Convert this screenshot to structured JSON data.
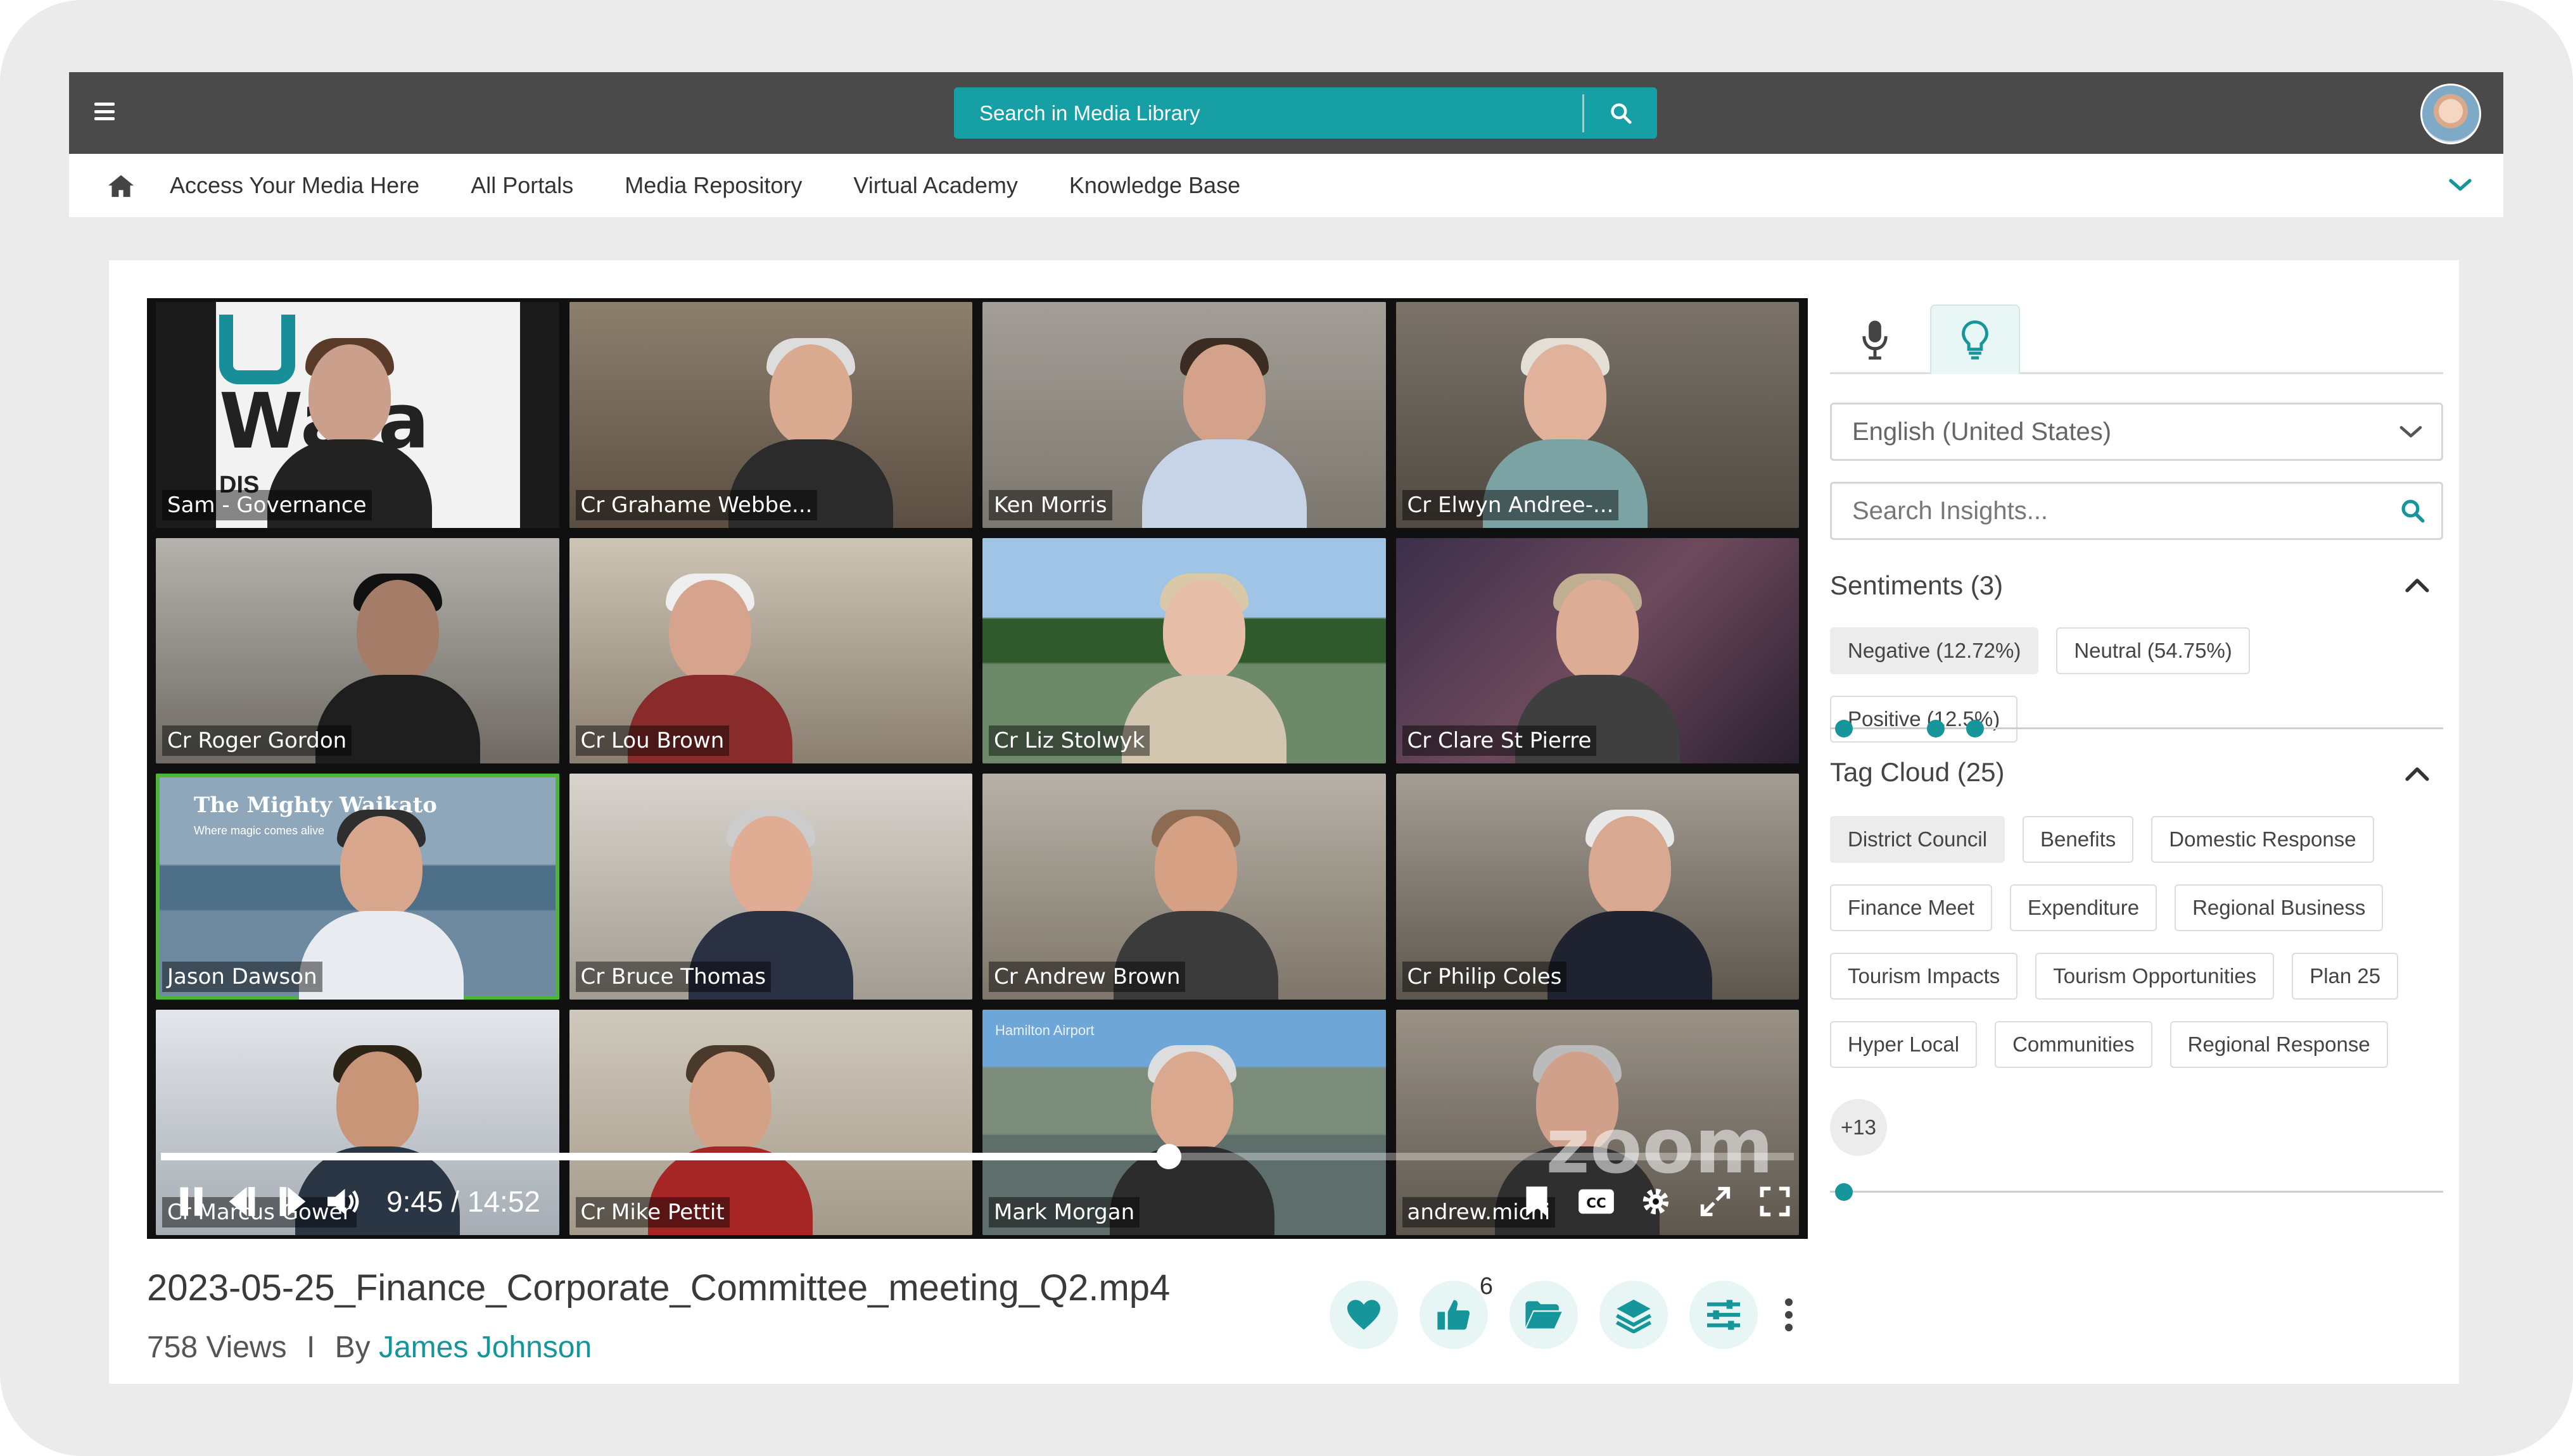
{
  "colors": {
    "topbar": "#4a4a4a",
    "accent": "#16a0a5",
    "link": "#16969b",
    "active_speaker": "#4fb43a"
  },
  "header": {
    "search_placeholder": "Search in Media Library",
    "menu_icon": "hamburger-icon",
    "search_icon": "search-icon",
    "avatar_icon": "user-avatar"
  },
  "nav": {
    "home_icon": "home-icon",
    "items": [
      {
        "label": "Access Your Media Here"
      },
      {
        "label": "All Portals"
      },
      {
        "label": "Media Repository"
      },
      {
        "label": "Virtual Academy"
      },
      {
        "label": "Knowledge Base"
      }
    ],
    "expand_icon": "chevron-down-icon"
  },
  "video": {
    "participants": [
      {
        "name": "Sam - Governance"
      },
      {
        "name": "Cr Grahame Webbe..."
      },
      {
        "name": "Ken Morris"
      },
      {
        "name": "Cr Elwyn Andree-..."
      },
      {
        "name": "Cr Roger Gordon"
      },
      {
        "name": "Cr Lou Brown"
      },
      {
        "name": "Cr Liz Stolwyk"
      },
      {
        "name": "Cr Clare St Pierre"
      },
      {
        "name": "Jason Dawson"
      },
      {
        "name": "Cr Bruce Thomas"
      },
      {
        "name": "Cr Andrew Brown"
      },
      {
        "name": "Cr Philip Coles"
      },
      {
        "name": "Cr Marcus Gower"
      },
      {
        "name": "Cr Mike Pettit"
      },
      {
        "name": "Mark Morgan"
      },
      {
        "name": "andrew.michi"
      }
    ],
    "logo_text": "Wa   a",
    "logo_sub": "DIS              IL",
    "sign_text": "The Mighty Waikato",
    "sign_sub": "Where magic comes alive",
    "airport_text": "Hamilton Airport",
    "zoom_watermark": "zoom",
    "time_display": "9:45 / 14:52",
    "progress": 0.617,
    "active_speaker": "Jason Dawson"
  },
  "media": {
    "title": "2023-05-25_Finance_Corporate_Committee_meeting_Q2.mp4",
    "views": "758 Views",
    "separator": "I",
    "by": "By",
    "author": "James Johnson",
    "like_count": "6",
    "action_icons": [
      "heart-icon",
      "thumbs-up-icon",
      "folder-icon",
      "layers-icon",
      "sliders-icon",
      "more-vertical-icon"
    ]
  },
  "insights": {
    "tabs": [
      "microphone-icon",
      "lightbulb-icon"
    ],
    "language": "English (United States)",
    "search_placeholder": "Search Insights...",
    "sentiments": {
      "title": "Sentiments (3)",
      "chips": [
        "Negative (12.72%)",
        "Neutral (54.75%)",
        "Positive (12.5%)"
      ],
      "markers": [
        0.023,
        0.173,
        0.237
      ]
    },
    "tags": {
      "title": "Tag Cloud (25)",
      "chips": [
        "District Council",
        "Benefits",
        "Domestic Response",
        "Finance Meet",
        "Expenditure",
        "Regional Business",
        "Tourism Impacts",
        "Tourism Opportunities",
        "Plan 25",
        "Hyper Local",
        "Communities",
        "Regional Response"
      ],
      "more": "+13",
      "markers": [
        0.023
      ]
    }
  }
}
